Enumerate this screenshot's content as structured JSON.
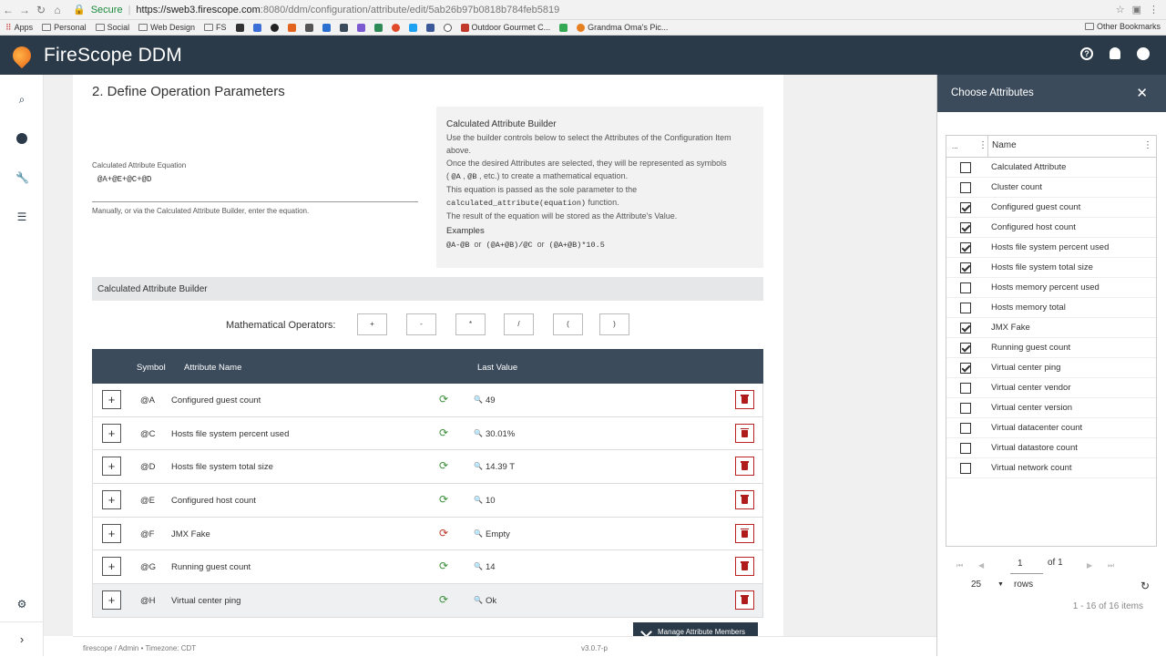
{
  "browser": {
    "secure_label": "Secure",
    "url_host": "https://sweb3.firescope.com",
    "url_path": ":8080/ddm/configuration/attribute/edit/5ab26b97b0818b784feb5819",
    "bookmarks": [
      "Apps",
      "Personal",
      "Social",
      "Web Design",
      "FS",
      "Outdoor Gourmet C...",
      "Grandma Oma's Pic..."
    ],
    "other_bookmarks": "Other Bookmarks"
  },
  "app": {
    "brand_prefix": "FireScope",
    "brand_suffix": "DDM"
  },
  "section": {
    "title": "2. Define Operation Parameters",
    "equation_label": "Calculated Attribute Equation",
    "equation_value": "@A+@E+@C+@D",
    "equation_help": "Manually, or via the Calculated Attribute Builder, enter the equation."
  },
  "builder_help": {
    "title": "Calculated Attribute Builder",
    "line1": "Use the builder controls below to select the Attributes of the Configuration Item above.",
    "line2": "Once the desired Attributes are selected, they will be represented as symbols",
    "line3_pre": "(",
    "line3_code1": "@A",
    "line3_sep": ",",
    "line3_code2": "@B",
    "line3_post": ", etc.) to create a mathematical equation.",
    "line4": "This equation is passed as the sole parameter to the",
    "line5_code": "calculated_attribute(equation)",
    "line5_post": "function.",
    "line6": "The result of the equation will be stored as the Attribute's Value.",
    "examples_title": "Examples",
    "ex1": "@A-@B",
    "ex_or1": "or",
    "ex2": "(@A+@B)/@C",
    "ex_or2": "or",
    "ex3": "(@A+@B)*10.5"
  },
  "builder": {
    "bar_title": "Calculated Attribute Builder",
    "operators_label": "Mathematical Operators:",
    "operators": [
      "+",
      "-",
      "*",
      "/",
      "(",
      ")"
    ]
  },
  "attr_table": {
    "headers": {
      "symbol": "Symbol",
      "name": "Attribute Name",
      "last_value": "Last Value"
    },
    "rows": [
      {
        "symbol": "@A",
        "name": "Configured guest count",
        "value": "49",
        "status": "ok"
      },
      {
        "symbol": "@C",
        "name": "Hosts file system percent used",
        "value": "30.01%",
        "status": "ok"
      },
      {
        "symbol": "@D",
        "name": "Hosts file system total size",
        "value": "14.39 T",
        "status": "ok"
      },
      {
        "symbol": "@E",
        "name": "Configured host count",
        "value": "10",
        "status": "ok"
      },
      {
        "symbol": "@F",
        "name": "JMX Fake",
        "value": "Empty",
        "status": "warn"
      },
      {
        "symbol": "@G",
        "name": "Running guest count",
        "value": "14",
        "status": "ok"
      },
      {
        "symbol": "@H",
        "name": "Virtual center ping",
        "value": "Ok",
        "status": "ok"
      }
    ],
    "manage_button": "Manage Attribute Members"
  },
  "footer": {
    "left": "firescope / Admin • Timezone: CDT",
    "version": "v3.0.7-p"
  },
  "right_panel": {
    "title": "Choose Attributes",
    "col_dots": "...",
    "col_name": "Name",
    "items": [
      {
        "name": "Calculated Attribute",
        "checked": false
      },
      {
        "name": "Cluster count",
        "checked": false
      },
      {
        "name": "Configured guest count",
        "checked": true
      },
      {
        "name": "Configured host count",
        "checked": true
      },
      {
        "name": "Hosts file system percent used",
        "checked": true
      },
      {
        "name": "Hosts file system total size",
        "checked": true
      },
      {
        "name": "Hosts memory percent used",
        "checked": false
      },
      {
        "name": "Hosts memory total",
        "checked": false
      },
      {
        "name": "JMX Fake",
        "checked": true
      },
      {
        "name": "Running guest count",
        "checked": true
      },
      {
        "name": "Virtual center ping",
        "checked": true
      },
      {
        "name": "Virtual center vendor",
        "checked": false
      },
      {
        "name": "Virtual center version",
        "checked": false
      },
      {
        "name": "Virtual datacenter count",
        "checked": false
      },
      {
        "name": "Virtual datastore count",
        "checked": false
      },
      {
        "name": "Virtual network count",
        "checked": false
      }
    ],
    "pager": {
      "page": "1",
      "of": "of 1",
      "page_size": "25",
      "rows_label": "rows",
      "count": "1 - 16 of 16 items"
    }
  },
  "colors": {
    "header_bg": "#2b3a48",
    "table_head_bg": "#3b4b5c",
    "ok_green": "#3a8f3a",
    "delete_red": "#b01c1c"
  }
}
